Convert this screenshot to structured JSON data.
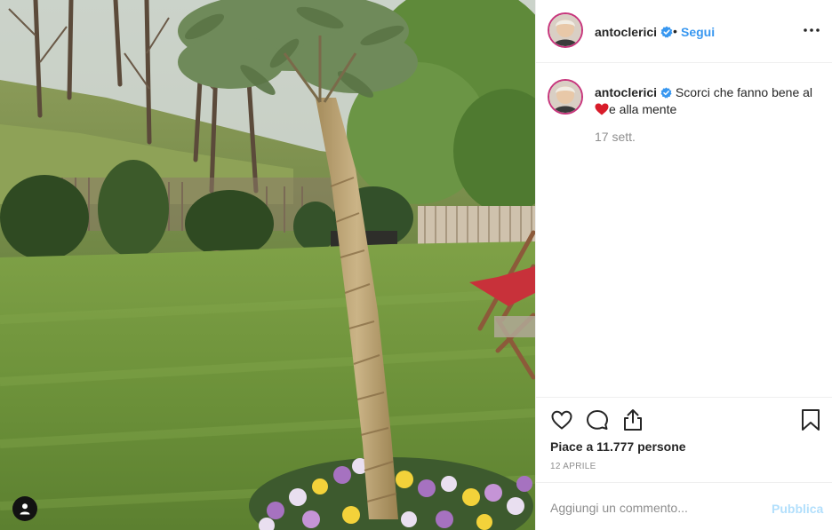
{
  "post": {
    "photo_alt": "",
    "colors": {
      "accent": "#3897f0",
      "story_ring": "#c7367c",
      "muted": "#8e8e8e"
    }
  },
  "header": {
    "username": "antoclerici",
    "separator": "•",
    "follow_label": "Segui",
    "verified_icon": "verified-badge-icon",
    "more_icon": "more-options-icon"
  },
  "caption": {
    "username": "antoclerici",
    "text_before": "Scorci che fanno bene al",
    "heart_emoji": "❤️",
    "text_after": "e alla mente",
    "time": "17 sett."
  },
  "actions": {
    "like_icon": "heart-icon",
    "comment_icon": "comment-icon",
    "share_icon": "share-icon",
    "save_icon": "bookmark-icon"
  },
  "likes": {
    "label_prefix": "Piace a",
    "count": "11.777",
    "label_suffix": "persone"
  },
  "date": "12 aprile",
  "comment": {
    "placeholder": "Aggiungi un commento...",
    "publish_label": "Pubblica"
  }
}
